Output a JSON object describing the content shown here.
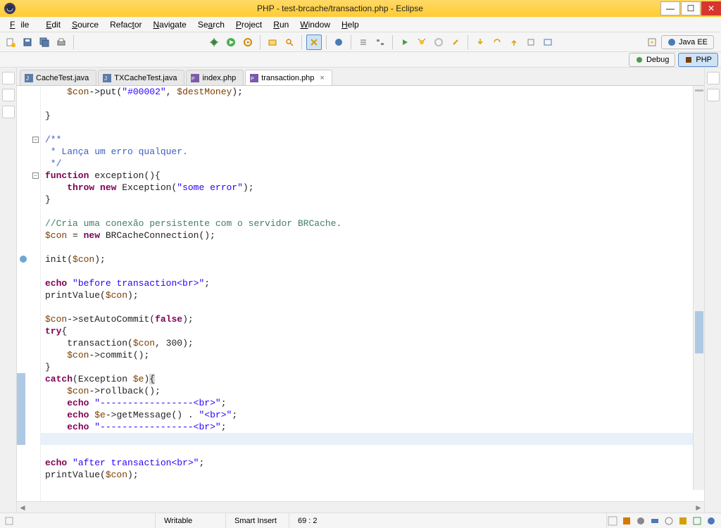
{
  "window": {
    "title": "PHP - test-brcache/transaction.php - Eclipse"
  },
  "menu": {
    "file": "File",
    "edit": "Edit",
    "source": "Source",
    "refactor": "Refactor",
    "navigate": "Navigate",
    "search": "Search",
    "project": "Project",
    "run": "Run",
    "window": "Window",
    "help": "Help"
  },
  "perspectives": {
    "javaee": "Java EE",
    "debug": "Debug",
    "php": "PHP"
  },
  "tabs": [
    {
      "label": "CacheTest.java",
      "active": false
    },
    {
      "label": "TXCacheTest.java",
      "active": false
    },
    {
      "label": "index.php",
      "active": false
    },
    {
      "label": "transaction.php",
      "active": true
    }
  ],
  "status": {
    "writable": "Writable",
    "insert": "Smart Insert",
    "pos": "69 : 2"
  },
  "code_lines": [
    {
      "t": [
        "    ",
        [
          "var",
          "$con"
        ],
        [
          "op",
          "->"
        ],
        [
          "fn",
          "put"
        ],
        "(",
        [
          "str",
          "\"#00002\""
        ],
        ", ",
        [
          "var",
          "$destMoney"
        ],
        ");"
      ]
    },
    {
      "t": [
        ""
      ]
    },
    {
      "t": [
        "}"
      ]
    },
    {
      "t": [
        ""
      ]
    },
    {
      "t": [
        [
          "dcmt",
          "/**"
        ]
      ],
      "fold": true
    },
    {
      "t": [
        [
          "dcmt",
          " * Lança um erro qualquer."
        ]
      ]
    },
    {
      "t": [
        [
          "dcmt",
          " */"
        ]
      ]
    },
    {
      "t": [
        [
          "kw",
          "function"
        ],
        " ",
        [
          "fn",
          "exception"
        ],
        "(){"
      ],
      "fold": true
    },
    {
      "t": [
        "    ",
        [
          "kw",
          "throw"
        ],
        " ",
        [
          "kw",
          "new"
        ],
        " Exception(",
        [
          "str",
          "\"some error\""
        ],
        ");"
      ]
    },
    {
      "t": [
        "}"
      ]
    },
    {
      "t": [
        ""
      ]
    },
    {
      "t": [
        [
          "cmt",
          "//Cria uma conexão persistente com o servidor BRCache."
        ]
      ]
    },
    {
      "t": [
        [
          "var",
          "$con"
        ],
        " = ",
        [
          "kw",
          "new"
        ],
        " BRCacheConnection();"
      ]
    },
    {
      "t": [
        ""
      ]
    },
    {
      "t": [
        [
          "fn",
          "init"
        ],
        "(",
        [
          "var",
          "$con"
        ],
        ");"
      ],
      "warn": true
    },
    {
      "t": [
        ""
      ]
    },
    {
      "t": [
        [
          "kw",
          "echo"
        ],
        " ",
        [
          "str",
          "\"before transaction<br>\""
        ],
        ";"
      ]
    },
    {
      "t": [
        [
          "fn",
          "printValue"
        ],
        "(",
        [
          "var",
          "$con"
        ],
        ");"
      ]
    },
    {
      "t": [
        ""
      ]
    },
    {
      "t": [
        [
          "var",
          "$con"
        ],
        [
          "op",
          "->"
        ],
        [
          "fn",
          "setAutoCommit"
        ],
        "(",
        [
          "kw",
          "false"
        ],
        ");"
      ]
    },
    {
      "t": [
        [
          "kw",
          "try"
        ],
        "{"
      ]
    },
    {
      "t": [
        "    ",
        [
          "fn",
          "transaction"
        ],
        "(",
        [
          "var",
          "$con"
        ],
        ", 300);"
      ]
    },
    {
      "t": [
        "    ",
        [
          "var",
          "$con"
        ],
        [
          "op",
          "->"
        ],
        [
          "fn",
          "commit"
        ],
        "();"
      ]
    },
    {
      "t": [
        "}"
      ]
    },
    {
      "t": [
        [
          "kw",
          "catch"
        ],
        "(Exception ",
        [
          "var",
          "$e"
        ],
        ")",
        [
          "brk",
          "{"
        ]
      ],
      "hl_start": true
    },
    {
      "t": [
        "    ",
        [
          "var",
          "$con"
        ],
        [
          "op",
          "->"
        ],
        [
          "fn",
          "rollback"
        ],
        "();"
      ]
    },
    {
      "t": [
        "    ",
        [
          "kw",
          "echo"
        ],
        " ",
        [
          "str",
          "\"-----------------<br>\""
        ],
        ";"
      ]
    },
    {
      "t": [
        "    ",
        [
          "kw",
          "echo"
        ],
        " ",
        [
          "var",
          "$e"
        ],
        [
          "op",
          "->"
        ],
        [
          "fn",
          "getMessage"
        ],
        "() . ",
        [
          "str",
          "\"<br>\""
        ],
        ";"
      ]
    },
    {
      "t": [
        "    ",
        [
          "kw",
          "echo"
        ],
        " ",
        [
          "str",
          "\"-----------------<br>\""
        ],
        ";"
      ]
    },
    {
      "t": [
        [
          "brk",
          "}"
        ]
      ],
      "cursor": true,
      "hl_end": true
    },
    {
      "t": [
        ""
      ]
    },
    {
      "t": [
        [
          "kw",
          "echo"
        ],
        " ",
        [
          "str",
          "\"after transaction<br>\""
        ],
        ";"
      ]
    },
    {
      "t": [
        [
          "fn",
          "printValue"
        ],
        "(",
        [
          "var",
          "$con"
        ],
        ");"
      ]
    }
  ]
}
